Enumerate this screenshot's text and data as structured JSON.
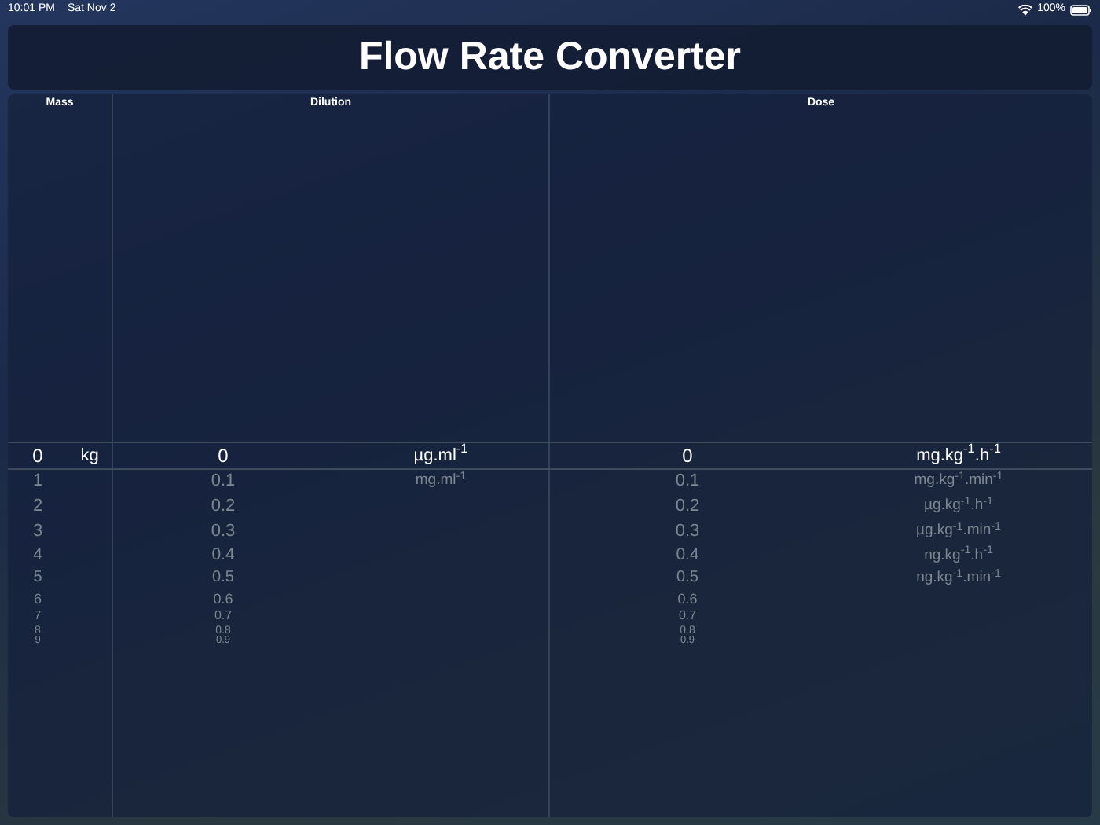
{
  "status_bar": {
    "time": "10:01 PM",
    "date": "Sat Nov 2",
    "battery": "100%"
  },
  "title": "Flow Rate Converter",
  "sections": [
    {
      "title": "Mass",
      "wheels": [
        {
          "kind": "value",
          "items": [
            {
              "label": "0",
              "selected": true
            },
            {
              "label": "1",
              "selected": false
            },
            {
              "label": "2",
              "selected": false
            },
            {
              "label": "3",
              "selected": false
            },
            {
              "label": "4",
              "selected": false
            },
            {
              "label": "5",
              "selected": false
            },
            {
              "label": "6",
              "selected": false
            },
            {
              "label": "7",
              "selected": false
            },
            {
              "label": "8",
              "selected": false
            },
            {
              "label": "9",
              "selected": false
            }
          ]
        },
        {
          "kind": "unit",
          "items": [
            {
              "label": "kg",
              "selected": true
            }
          ]
        }
      ]
    },
    {
      "title": "Dilution",
      "wheels": [
        {
          "kind": "value",
          "items": [
            {
              "label": "0",
              "selected": true
            },
            {
              "label": "0.1",
              "selected": false
            },
            {
              "label": "0.2",
              "selected": false
            },
            {
              "label": "0.3",
              "selected": false
            },
            {
              "label": "0.4",
              "selected": false
            },
            {
              "label": "0.5",
              "selected": false
            },
            {
              "label": "0.6",
              "selected": false
            },
            {
              "label": "0.7",
              "selected": false
            },
            {
              "label": "0.8",
              "selected": false
            },
            {
              "label": "0.9",
              "selected": false
            }
          ]
        },
        {
          "kind": "unit",
          "items": [
            {
              "label": "µg.ml$^{-1}$",
              "selected": true
            },
            {
              "label": "mg.ml$^{-1}$",
              "selected": false
            }
          ]
        }
      ]
    },
    {
      "title": "Dose",
      "wheels": [
        {
          "kind": "value",
          "items": [
            {
              "label": "0",
              "selected": true
            },
            {
              "label": "0.1",
              "selected": false
            },
            {
              "label": "0.2",
              "selected": false
            },
            {
              "label": "0.3",
              "selected": false
            },
            {
              "label": "0.4",
              "selected": false
            },
            {
              "label": "0.5",
              "selected": false
            },
            {
              "label": "0.6",
              "selected": false
            },
            {
              "label": "0.7",
              "selected": false
            },
            {
              "label": "0.8",
              "selected": false
            },
            {
              "label": "0.9",
              "selected": false
            }
          ]
        },
        {
          "kind": "unit",
          "items": [
            {
              "label": "mg.kg$^{-1}$.h$^{-1}$",
              "selected": true
            },
            {
              "label": "mg.kg$^{-1}$.min$^{-1}$",
              "selected": false
            },
            {
              "label": "µg.kg$^{-1}$.h$^{-1}$",
              "selected": false
            },
            {
              "label": "µg.kg$^{-1}$.min$^{-1}$",
              "selected": false
            },
            {
              "label": "ng.kg$^{-1}$.h$^{-1}$",
              "selected": false
            },
            {
              "label": "ng.kg$^{-1}$.min$^{-1}$",
              "selected": false
            }
          ]
        }
      ]
    }
  ]
}
